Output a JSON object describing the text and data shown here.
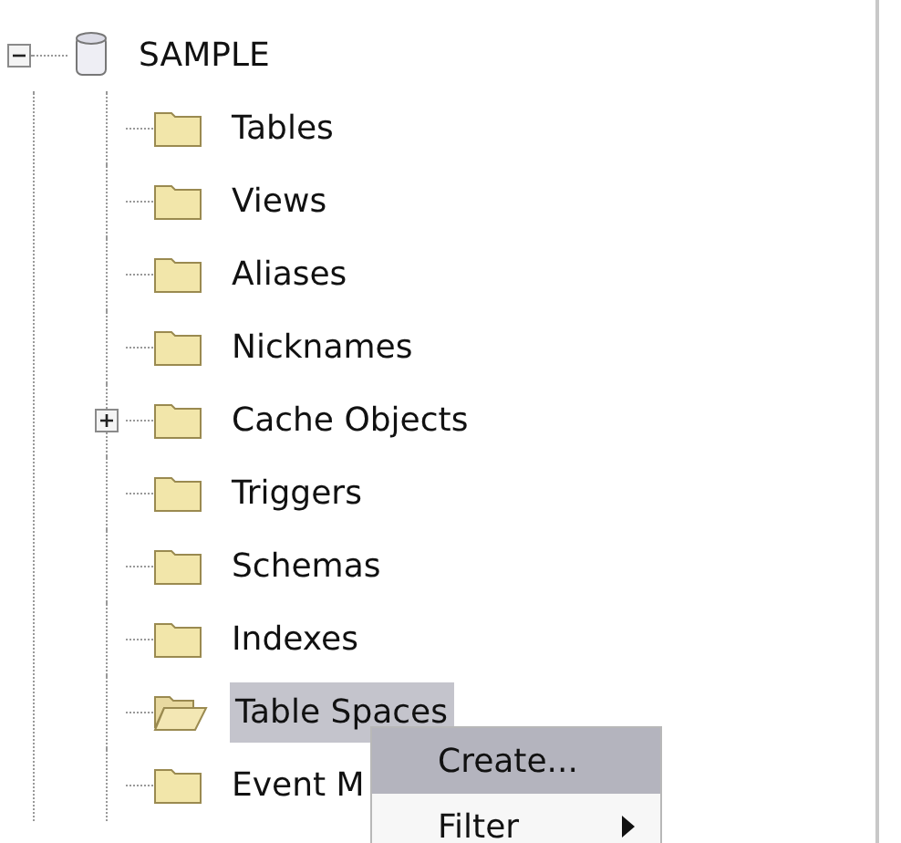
{
  "tree": {
    "root": {
      "label": "SAMPLE",
      "expanded": true,
      "children": [
        {
          "label": "Tables",
          "collapsed": false,
          "selected": false
        },
        {
          "label": "Views",
          "collapsed": false,
          "selected": false
        },
        {
          "label": "Aliases",
          "collapsed": false,
          "selected": false
        },
        {
          "label": "Nicknames",
          "collapsed": false,
          "selected": false
        },
        {
          "label": "Cache Objects",
          "collapsed": true,
          "selected": false
        },
        {
          "label": "Triggers",
          "collapsed": false,
          "selected": false
        },
        {
          "label": "Schemas",
          "collapsed": false,
          "selected": false
        },
        {
          "label": "Indexes",
          "collapsed": false,
          "selected": false
        },
        {
          "label": "Table Spaces",
          "collapsed": false,
          "selected": true
        },
        {
          "label": "Event M",
          "collapsed": false,
          "selected": false
        }
      ]
    }
  },
  "context_menu": {
    "items": [
      {
        "label": "Create...",
        "selected": true,
        "submenu": false
      },
      {
        "label": "Filter",
        "selected": false,
        "submenu": true
      }
    ]
  }
}
